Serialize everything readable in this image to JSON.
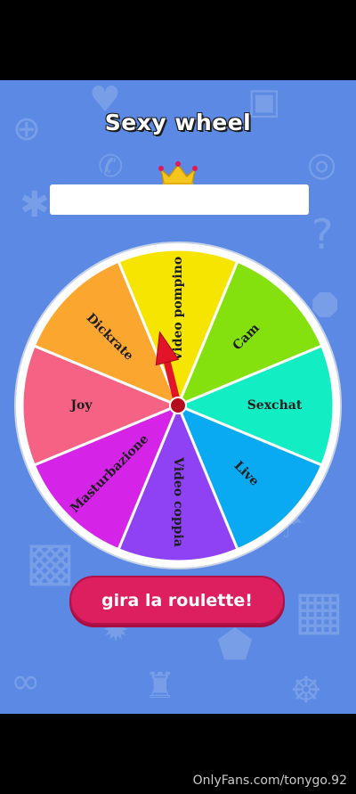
{
  "app": {
    "title": "Sexy wheel",
    "result_value": ""
  },
  "wheel": {
    "segments": [
      {
        "label": "Video pompino",
        "color": "#f6e500"
      },
      {
        "label": "Cam",
        "color": "#84e10e"
      },
      {
        "label": "Sexchat",
        "color": "#12edc3"
      },
      {
        "label": "Live",
        "color": "#09aaf2"
      },
      {
        "label": "Video coppia",
        "color": "#8e42f3"
      },
      {
        "label": "Masturbazione",
        "color": "#d524e7"
      },
      {
        "label": "Joy",
        "color": "#f66284"
      },
      {
        "label": "Dickrate",
        "color": "#fba62f"
      }
    ],
    "pointer_color": "#e11428",
    "hub_color": "#b40d1c"
  },
  "spin_button": {
    "label": "gira la roulette!",
    "color": "#dd1e5f"
  },
  "watermark": "OnlyFans.com/tonygo.92",
  "background_icons": [
    "gamepad-icon",
    "heart-icon",
    "camera-icon",
    "phone-icon",
    "target-icon",
    "octopus-icon",
    "question-icon",
    "stop-sign-icon",
    "parachute-icon",
    "cube-icon",
    "calendar-icon",
    "sun-icon",
    "pin-icon",
    "binoculars-icon",
    "chess-rook-icon",
    "crab-icon"
  ]
}
